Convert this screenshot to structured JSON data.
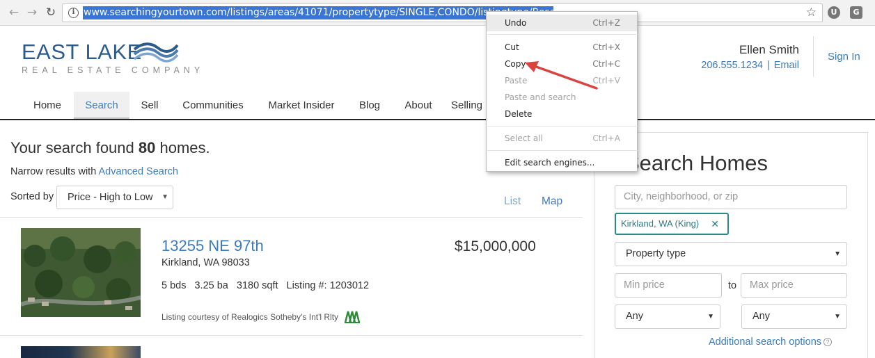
{
  "browser": {
    "url": "www.searchingyourtown.com/listings/areas/41071/propertytype/SINGLE,CONDO/listingtype/Resale%20New/",
    "ext1": "U",
    "ext2": "G"
  },
  "site": {
    "logo_main": "EAST LAKE",
    "logo_sub": "REAL ESTATE COMPANY",
    "agent_name": "Ellen Smith",
    "agent_phone": "206.555.1234",
    "agent_sep": "|",
    "agent_email": "Email",
    "signin": "Sign In"
  },
  "nav": {
    "items": [
      {
        "label": "Home"
      },
      {
        "label": "Search"
      },
      {
        "label": "Sell"
      },
      {
        "label": "Communities"
      },
      {
        "label": "Market Insider"
      },
      {
        "label": "Blog"
      },
      {
        "label": "About"
      },
      {
        "label": "Selling"
      }
    ],
    "active": "Search"
  },
  "results": {
    "title_prefix": "Your search found ",
    "count": "80",
    "title_suffix": " homes.",
    "narrow_prefix": "Narrow results with ",
    "narrow_link": "Advanced Search",
    "sorted_by": "Sorted by",
    "sort_value": "Price - High to Low",
    "view_list": "List",
    "view_map": "Map"
  },
  "listing": {
    "address": "13255 NE 97th",
    "city": "Kirkland, WA 98033",
    "beds": "5 bds",
    "baths": "3.25 ba",
    "sqft": "3180 sqft",
    "listing_num": "Listing #: 1203012",
    "price": "$15,000,000",
    "courtesy": "Listing courtesy of Realogics Sotheby's Int'l Rlty"
  },
  "search_panel": {
    "title": "Search Homes",
    "location_placeholder": "City, neighborhood, or zip",
    "chip": "Kirkland, WA (King)",
    "property_type": "Property type",
    "min_price": "Min price",
    "to": "to",
    "max_price": "Max price",
    "any1": "Any",
    "any2": "Any",
    "additional": "Additional search options",
    "help": "?"
  },
  "context_menu": {
    "undo": "Undo",
    "undo_sc": "Ctrl+Z",
    "cut": "Cut",
    "cut_sc": "Ctrl+X",
    "copy": "Copy",
    "copy_sc": "Ctrl+C",
    "paste": "Paste",
    "paste_sc": "Ctrl+V",
    "paste_search": "Paste and search",
    "delete": "Delete",
    "select_all": "Select all",
    "select_all_sc": "Ctrl+A",
    "edit_engines": "Edit search engines..."
  },
  "colors": {
    "link": "#3b7bbf",
    "url_highlight": "#3875d7",
    "arrow": "#d9443f",
    "chip_border": "#2a8a8a"
  }
}
